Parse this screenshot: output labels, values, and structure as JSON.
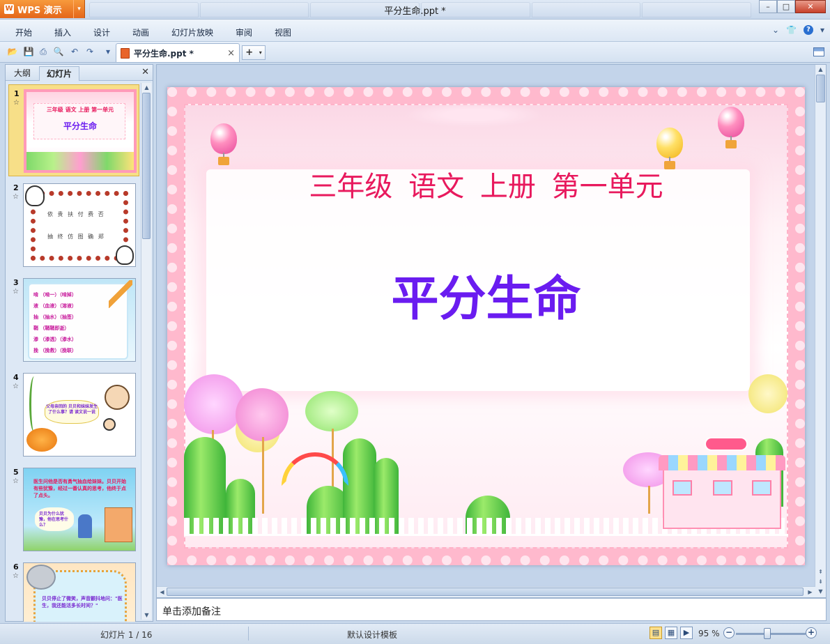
{
  "app": {
    "name": "WPS 演示",
    "window_title": "平分生命.ppt *"
  },
  "menu": [
    "开始",
    "插入",
    "设计",
    "动画",
    "幻灯片放映",
    "审阅",
    "视图"
  ],
  "doc_tab": {
    "label": "平分生命.ppt *"
  },
  "left_panel": {
    "tabs": [
      "大纲",
      "幻灯片"
    ],
    "active_tab": "幻灯片",
    "slides": [
      {
        "num": "1",
        "line1": "三年级 语文 上册 第一单元",
        "line2": "平分生命"
      },
      {
        "num": "2",
        "row1": "依 贵 扶 付 费 否",
        "row2": "抽 终 仿 图 确 郑"
      },
      {
        "num": "3",
        "rows": [
          "啃 （啃一）（啃掉）",
          "液 （血液）（溶液）",
          "抽 （抽水）（抽签）",
          "鞘 （鞘鞘即逝）",
          "渗 （渗透）（渗水）",
          "挽 （挽救）（挽联）"
        ]
      },
      {
        "num": "4",
        "bubble": "父母亲回的 贝贝和妹妹发生了什么事？请 读文说一说"
      },
      {
        "num": "5",
        "text": "医生问他是否有勇气抽血给妹妹。贝贝开始有些犹豫，经过一番认真的思考，他终于点了点头。",
        "bubble": "贝贝为什么犹豫，他在思考什么？"
      },
      {
        "num": "6",
        "text": "贝贝停止了微笑，声音颤抖地问：\"医生，我还能活多长时间？\""
      }
    ]
  },
  "slide": {
    "subtitle": "三年级  语文    上册  第一单元",
    "title": "平分生命"
  },
  "notes": {
    "placeholder": "单击添加备注"
  },
  "status": {
    "slide_counter": "幻灯片 1 / 16",
    "template": "默认设计模板",
    "zoom": "95 %"
  },
  "colors": {
    "accent": "#e4661a",
    "subtitle": "#e8195d",
    "title": "#6a1cf0",
    "slide_frame": "#ffb9cd"
  }
}
